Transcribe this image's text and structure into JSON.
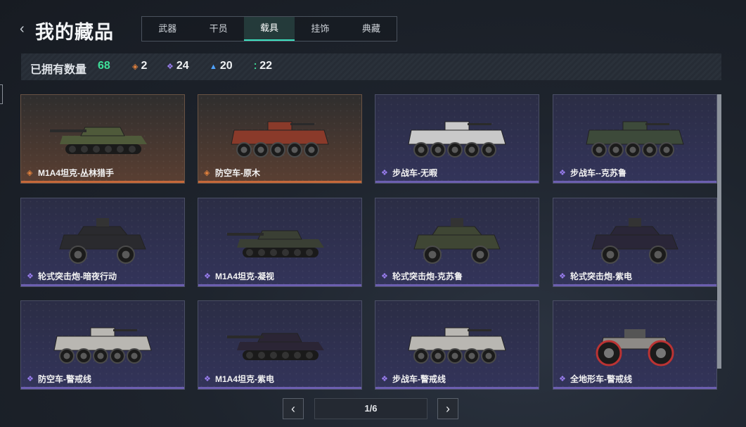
{
  "header": {
    "back_glyph": "‹",
    "title": "我的藏品"
  },
  "tabs": [
    {
      "label": "武器",
      "active": false
    },
    {
      "label": "干员",
      "active": false
    },
    {
      "label": "载具",
      "active": true
    },
    {
      "label": "挂饰",
      "active": false
    },
    {
      "label": "典藏",
      "active": false
    }
  ],
  "stats": {
    "owned_label": "已拥有数量",
    "owned_count": "68",
    "tiers": [
      {
        "icon": "orange-diamond-icon",
        "color": "#e4823d",
        "value": "2"
      },
      {
        "icon": "purple-diamond-icon",
        "color": "#9a7ef0",
        "value": "24"
      },
      {
        "icon": "blue-triangle-icon",
        "color": "#4fa3ff",
        "value": "20"
      },
      {
        "icon": "green-dots-icon",
        "color": "#3ee09a",
        "value": "22"
      }
    ]
  },
  "cards": [
    {
      "name": "M1A4坦克-丛林猎手",
      "rarity": "orange",
      "vehicle": "tank",
      "camo": "#4f5a3a"
    },
    {
      "name": "防空车-原木",
      "rarity": "orange",
      "vehicle": "apc",
      "camo": "#8a3a2a"
    },
    {
      "name": "步战车-无暇",
      "rarity": "purple",
      "vehicle": "apc",
      "camo": "#c9c9c9"
    },
    {
      "name": "步战车--克苏鲁",
      "rarity": "purple",
      "vehicle": "apc",
      "camo": "#3d4a3a"
    },
    {
      "name": "轮式突击炮-暗夜行动",
      "rarity": "purple",
      "vehicle": "armored",
      "camo": "#2a2a2e"
    },
    {
      "name": "M1A4坦克-凝视",
      "rarity": "purple",
      "vehicle": "tank",
      "camo": "#3a3f34"
    },
    {
      "name": "轮式突击炮-克苏鲁",
      "rarity": "purple",
      "vehicle": "armored",
      "camo": "#3f4634"
    },
    {
      "name": "轮式突击炮-紫电",
      "rarity": "purple",
      "vehicle": "armored",
      "camo": "#2a2638"
    },
    {
      "name": "防空车-警戒线",
      "rarity": "purple",
      "vehicle": "apc",
      "camo": "#b9b7b2"
    },
    {
      "name": "M1A4坦克-紫电",
      "rarity": "purple",
      "vehicle": "tank",
      "camo": "#2b2535"
    },
    {
      "name": "步战车-警戒线",
      "rarity": "purple",
      "vehicle": "apc",
      "camo": "#b9b7b2"
    },
    {
      "name": "全地形车-警戒线",
      "rarity": "purple",
      "vehicle": "atv",
      "camo": "#8d8a86"
    }
  ],
  "pager": {
    "prev": "‹",
    "page": "1/6",
    "next": "›"
  }
}
